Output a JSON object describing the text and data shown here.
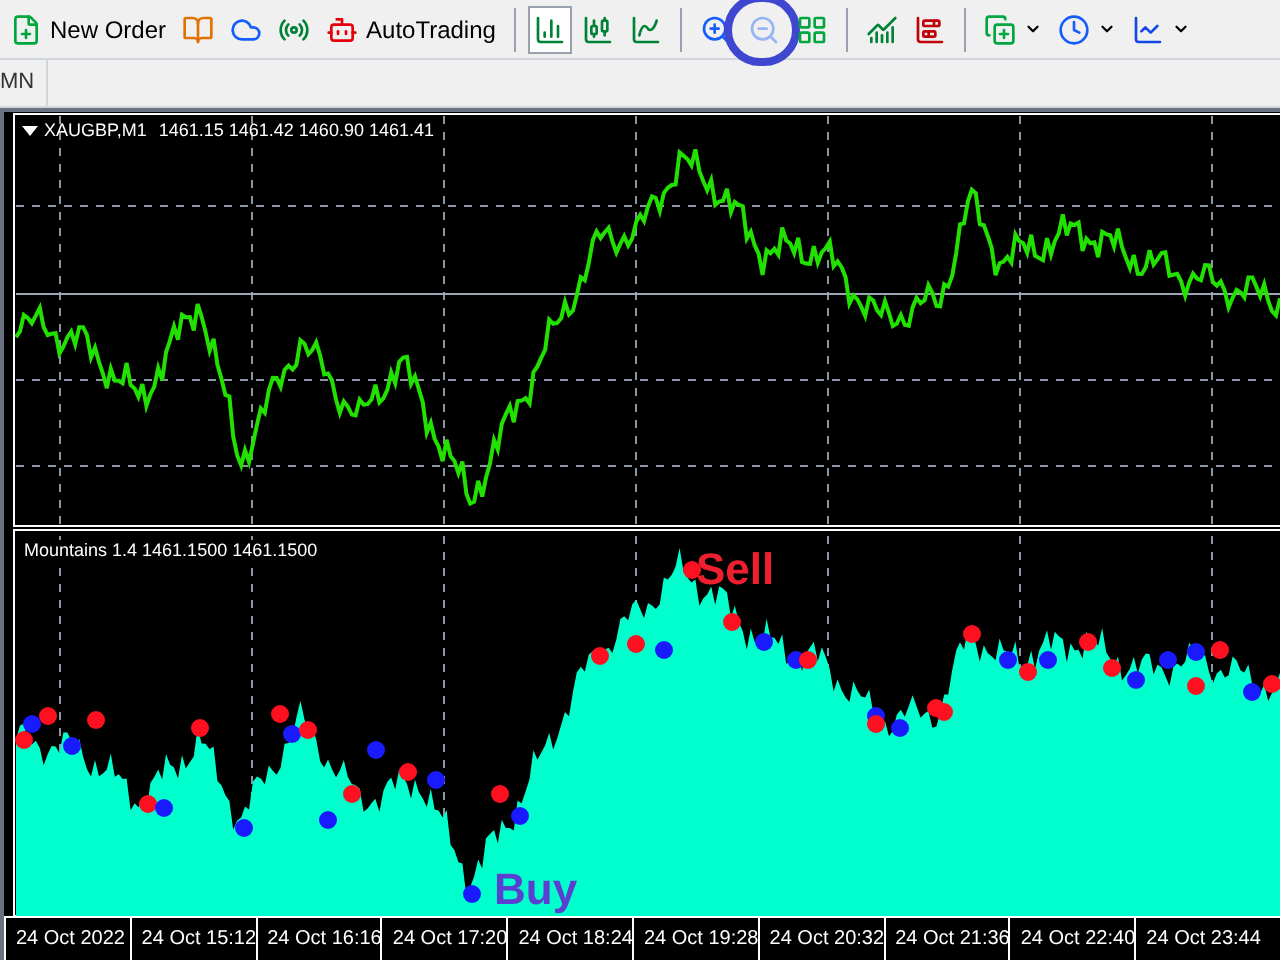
{
  "toolbar": {
    "groups": [
      [
        {
          "label": "New Order",
          "disabled": false,
          "pressed": false
        },
        {
          "disabled": false,
          "pressed": false
        },
        {
          "disabled": false,
          "pressed": false
        },
        {
          "disabled": false,
          "pressed": false
        },
        {
          "label": "AutoTrading",
          "disabled": false,
          "pressed": false
        }
      ],
      [
        {
          "disabled": false,
          "pressed": true
        },
        {
          "disabled": false,
          "pressed": false
        },
        {
          "disabled": false,
          "pressed": false
        }
      ],
      [
        {
          "disabled": false,
          "pressed": false
        },
        {
          "disabled": true,
          "pressed": false,
          "highlighted": true
        },
        {
          "disabled": false,
          "pressed": false
        }
      ],
      [
        {
          "disabled": false,
          "pressed": false
        },
        {
          "disabled": false,
          "pressed": false
        }
      ],
      [
        {
          "disabled": false,
          "pressed": false,
          "dropdown": true
        },
        {
          "disabled": false,
          "pressed": false,
          "dropdown": true
        },
        {
          "disabled": false,
          "pressed": false,
          "dropdown": true
        }
      ]
    ]
  },
  "periods": {
    "items": [
      "MN"
    ]
  },
  "chart": {
    "title": "XAUGBP,M1",
    "ohlc": "1461.15 1461.42 1460.90 1461.41"
  },
  "indicator": {
    "title": "Mountains 1.4 1461.1500 1461.1500",
    "sell_label": "Sell",
    "buy_label": "Buy"
  },
  "time_axis": [
    "24 Oct 2022",
    "24 Oct 15:12",
    "24 Oct 16:16",
    "24 Oct 17:20",
    "24 Oct 18:24",
    "24 Oct 19:28",
    "24 Oct 20:32",
    "24 Oct 21:36",
    "24 Oct 22:40",
    "24 Oct 23:44"
  ]
}
